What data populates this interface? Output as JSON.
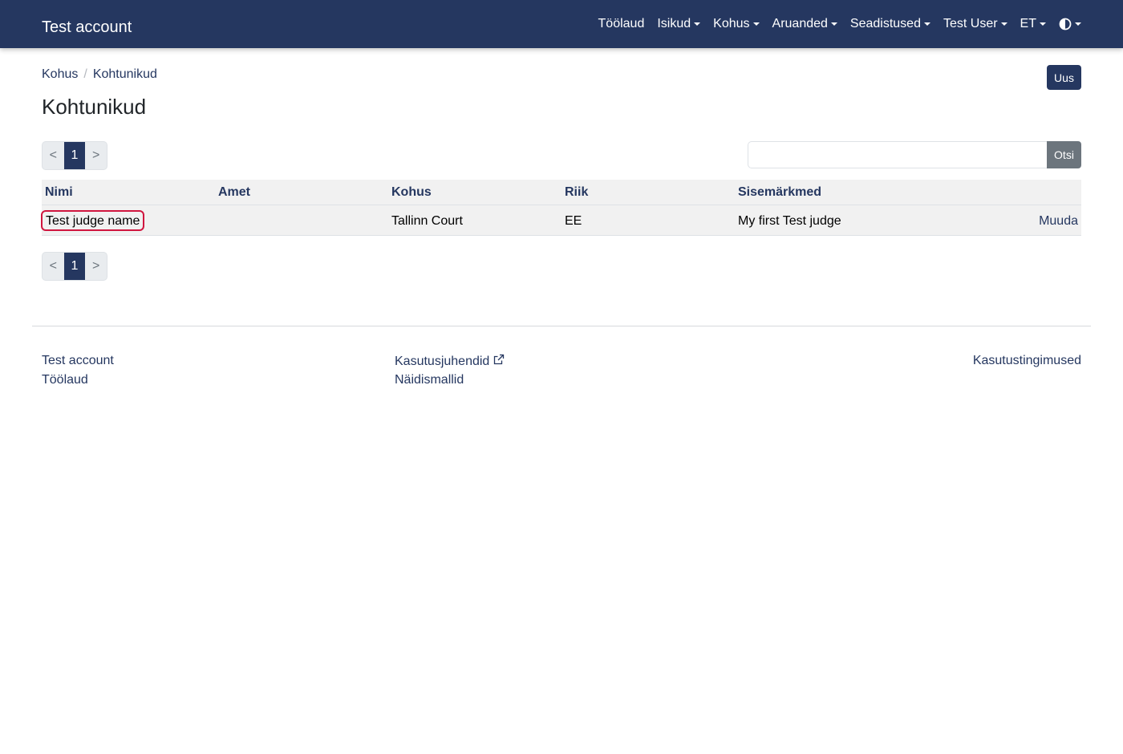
{
  "navbar": {
    "brand": "Test account",
    "items": [
      {
        "label": "Töölaud",
        "dropdown": false
      },
      {
        "label": "Isikud",
        "dropdown": true
      },
      {
        "label": "Kohus",
        "dropdown": true
      },
      {
        "label": "Aruanded",
        "dropdown": true
      },
      {
        "label": "Seadistused",
        "dropdown": true
      },
      {
        "label": "Test User",
        "dropdown": true
      },
      {
        "label": "ET",
        "dropdown": true
      }
    ],
    "theme_icon": "half-circle-contrast-icon"
  },
  "breadcrumb": [
    "Kohus",
    "Kohtunikud"
  ],
  "new_button": "Uus",
  "page_title": "Kohtunikud",
  "pagination": {
    "prev": "<",
    "current": "1",
    "next": ">"
  },
  "search": {
    "value": "",
    "placeholder": "",
    "button": "Otsi"
  },
  "table": {
    "headers": [
      "Nimi",
      "Amet",
      "Kohus",
      "Riik",
      "Sisemärkmed"
    ],
    "rows": [
      {
        "name": "Test judge name",
        "role": "",
        "court": "Tallinn Court",
        "country": "EE",
        "notes": "My first Test judge",
        "action": "Muuda"
      }
    ]
  },
  "footer": {
    "col1": [
      "Test account",
      "Töölaud"
    ],
    "col2": [
      "Kasutusjuhendid",
      "Näidismallid"
    ],
    "col3": [
      "Kasutustingimused"
    ],
    "external_icon": "external-link-icon"
  },
  "colors": {
    "primary": "#253760",
    "highlight": "#d0163f",
    "secondary": "#6c757d"
  }
}
